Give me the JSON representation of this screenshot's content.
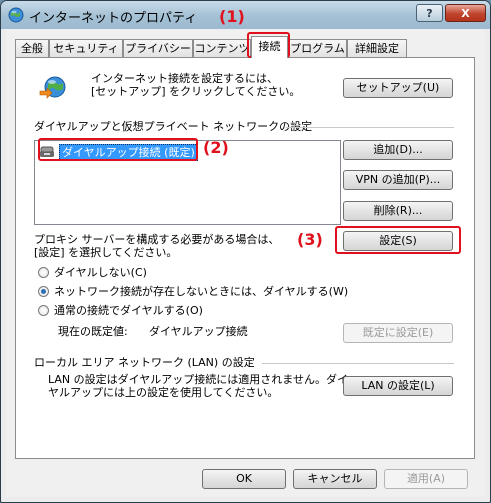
{
  "window": {
    "title": "インターネットのプロパティ",
    "help_label": "?",
    "close_label": "X"
  },
  "tabs": [
    {
      "label": "全般",
      "active": false
    },
    {
      "label": "セキュリティ",
      "active": false
    },
    {
      "label": "プライバシー",
      "active": false
    },
    {
      "label": "コンテンツ",
      "active": false
    },
    {
      "label": "接続",
      "active": true
    },
    {
      "label": "プログラム",
      "active": false
    },
    {
      "label": "詳細設定",
      "active": false
    }
  ],
  "setup": {
    "text_line1": "インターネット接続を設定するには、",
    "text_line2": "[セットアップ] をクリックしてください。",
    "button_label": "セットアップ(U)"
  },
  "dialup": {
    "section_label": "ダイヤルアップと仮想プライベート ネットワークの設定",
    "items": [
      {
        "label": "ダイヤルアップ接続 (既定)",
        "selected": true
      }
    ],
    "add_label": "追加(D)...",
    "add_vpn_label": "VPN の追加(P)...",
    "remove_label": "削除(R)...",
    "proxy_text_line1": "プロキシ サーバーを構成する必要がある場合は、",
    "proxy_text_line2": "[設定] を選択してください。",
    "settings_label": "設定(S)",
    "radios": [
      {
        "label": "ダイヤルしない(C)",
        "checked": false
      },
      {
        "label": "ネットワーク接続が存在しないときには、ダイヤルする(W)",
        "checked": true
      },
      {
        "label": "通常の接続でダイヤルする(O)",
        "checked": false
      }
    ],
    "current_default_label": "現在の既定値:",
    "current_default_value": "ダイヤルアップ接続",
    "set_default_label": "既定に設定(E)"
  },
  "lan": {
    "section_label": "ローカル エリア ネットワーク (LAN) の設定",
    "text_line1": "LAN の設定はダイヤルアップ接続には適用されません。ダイ",
    "text_line2": "ヤルアップには上の設定を使用してください。",
    "button_label": "LAN の設定(L)"
  },
  "footer": {
    "ok_label": "OK",
    "cancel_label": "キャンセル",
    "apply_label": "適用(A)"
  },
  "annotations": [
    {
      "label": "(1)"
    },
    {
      "label": "(2)"
    },
    {
      "label": "(3)"
    }
  ],
  "colors": {
    "callout": "#e0101c",
    "selection": "#3399ff"
  }
}
